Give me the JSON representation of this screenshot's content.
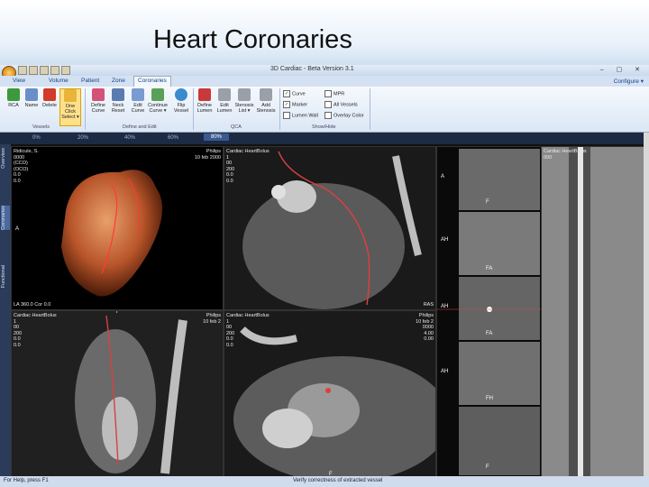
{
  "slide": {
    "title": "Heart Coronaries"
  },
  "app": {
    "window_title": "3D Cardiac - Beta Version 3.1",
    "window_buttons": "–  ▢  ✕",
    "tabs": [
      "View",
      "Volume",
      "Patient",
      "Zone",
      "Coronaries"
    ],
    "active_tab": "Coronaries",
    "configure_label": "Configure ▾",
    "ribbon": {
      "vessels": [
        {
          "label": "RCA",
          "icon": "arrow-icon",
          "color": "#3c9a3c"
        },
        {
          "label": "Name",
          "icon": "name-icon",
          "color": "#6a8fc8"
        },
        {
          "label": "Delete",
          "icon": "delete-icon",
          "color": "#d23a2a"
        },
        {
          "label": "One Click Select ▾",
          "icon": "cursor-icon",
          "color": "#e8b43a"
        }
      ],
      "vessels_group": "Vessels",
      "define_edit": [
        {
          "label": "Define Curve",
          "icon": "curve-icon",
          "color": "#d4527a"
        },
        {
          "label": "Neck Reset",
          "icon": "reset-icon",
          "color": "#5a7ab0"
        },
        {
          "label": "Edit Curve",
          "icon": "edit-curve-icon",
          "color": "#7a9ad0"
        },
        {
          "label": "Continue Curve ▾",
          "icon": "continue-icon",
          "color": "#5aa05a"
        },
        {
          "label": "Flip Vessel",
          "icon": "flip-icon",
          "color": "#3a8ad0"
        }
      ],
      "define_edit_group": "Define and Edit",
      "qca": [
        {
          "label": "Define Lumen",
          "icon": "lumen-icon",
          "color": "#c83a3a"
        },
        {
          "label": "Edit Lumen",
          "icon": "edit-lumen-icon",
          "color": "#9aa0aa"
        },
        {
          "label": "Stenosis List ▾",
          "icon": "list-icon",
          "color": "#9aa0aa"
        },
        {
          "label": "Add Stenosis",
          "icon": "add-icon",
          "color": "#9aa0aa"
        }
      ],
      "qca_group": "QCA",
      "show_hide": [
        {
          "label": "Curve",
          "checked": true
        },
        {
          "label": "Marker",
          "checked": true
        },
        {
          "label": "Lumen Wall",
          "checked": false
        },
        {
          "label": "MPR",
          "checked": false
        },
        {
          "label": "All Vessels",
          "checked": false
        },
        {
          "label": "Overlay Color",
          "checked": false
        }
      ],
      "show_hide_group": "Show/Hide"
    },
    "phases": [
      "0%",
      "20%",
      "40%",
      "60%",
      "80%"
    ],
    "active_phase": "80%",
    "side_tabs": [
      "Overview",
      "Coronaries",
      "Functional"
    ],
    "viewports": {
      "v3d": {
        "overlay_tl": "Ridicule, S.\n0000\n(CCO)\n(OCO)\n0.0\n0.0",
        "overlay_tr": "Philips\n10 feb 2000",
        "overlay_bl": "LA 360.0 Cor 0.0",
        "marker": "A"
      },
      "vmpr": {
        "overlay_tl": "Cardiac HeartBolus\n1\n00\n200\n0.0\n0.0",
        "overlay_br": "RAS"
      },
      "vsag": {
        "overlay_tl": "Cardiac HeartBolus\n1\n00\n200\n0.0\n0.0",
        "overlay_tr": "Philips\n10 feb 2",
        "marker": "F"
      },
      "vax": {
        "overlay_tl": "Cardiac HeartBolus\n1\n00\n200\n0.0\n0.0",
        "overlay_tr": "Philips\n10 feb 2\n0000\n4.00\n0.00",
        "marker": "F"
      },
      "vcross": [
        "A",
        "F",
        "AH",
        "FA",
        "AH",
        "FA",
        "AH",
        "FH",
        "F"
      ],
      "vstraight": {
        "overlay_tl": "Cardiac HeartBolus\n000"
      }
    },
    "status": {
      "left": "For Help, press F1",
      "right": "Verify correctness of extracted vessel"
    }
  }
}
